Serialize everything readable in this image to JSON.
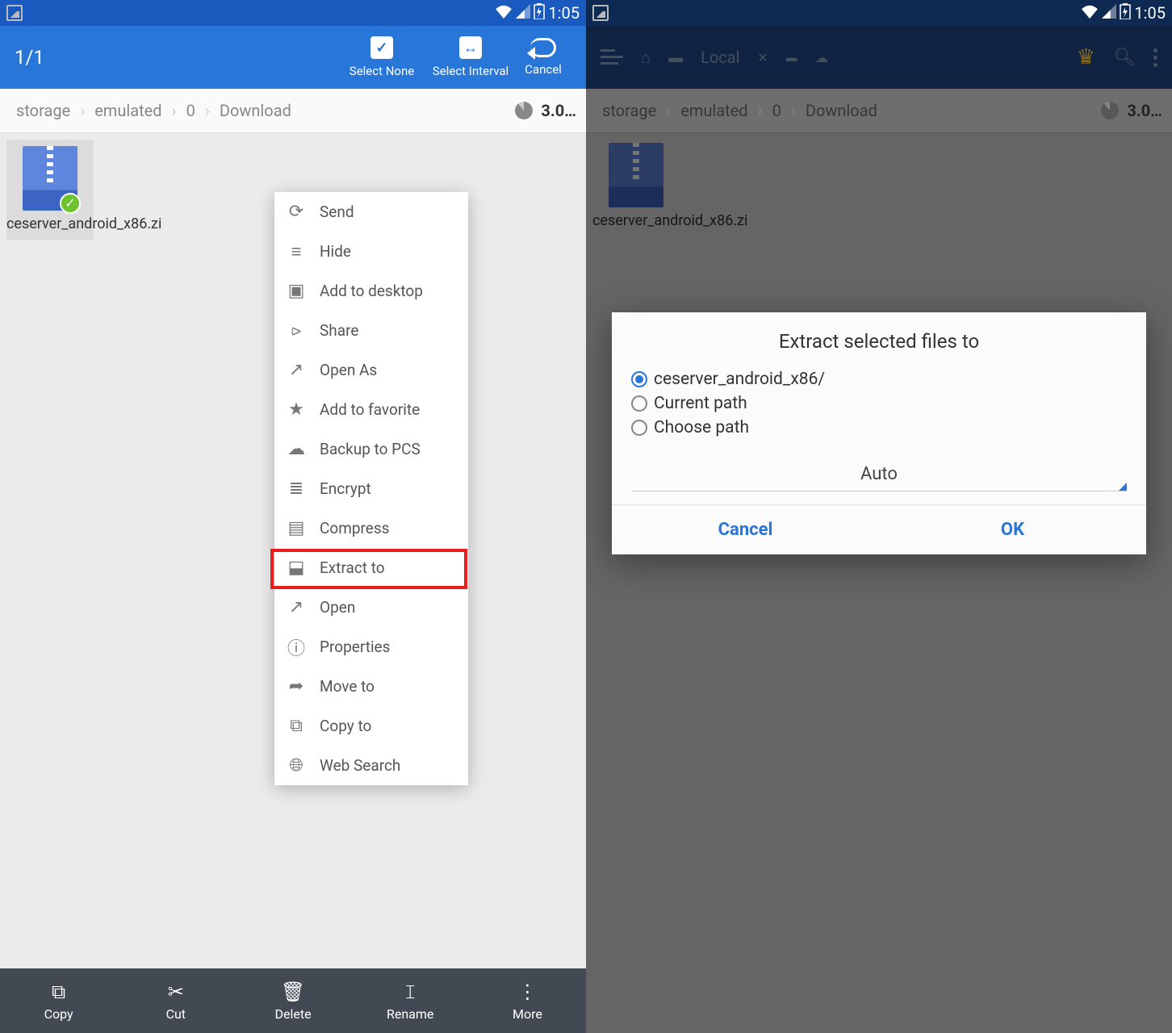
{
  "screen_left": {
    "status": {
      "time": "1:05"
    },
    "toolbar": {
      "count": "1/1",
      "select_none": "Select None",
      "select_interval": "Select Interval",
      "cancel": "Cancel"
    },
    "breadcrumb": [
      "storage",
      "emulated",
      "0",
      "Download"
    ],
    "storage_size": "3.0…",
    "file": {
      "name": "ceserver_android_x86.zi"
    },
    "context_menu": [
      "Send",
      "Hide",
      "Add to desktop",
      "Share",
      "Open As",
      "Add to favorite",
      "Backup to PCS",
      "Encrypt",
      "Compress",
      "Extract to",
      "Open",
      "Properties",
      "Move to",
      "Copy to",
      "Web Search"
    ],
    "bottom_bar": [
      "Copy",
      "Cut",
      "Delete",
      "Rename",
      "More"
    ]
  },
  "screen_right": {
    "status": {
      "time": "1:05"
    },
    "toolbar": {
      "local": "Local"
    },
    "breadcrumb": [
      "storage",
      "emulated",
      "0",
      "Download"
    ],
    "storage_size": "3.0…",
    "file": {
      "name": "ceserver_android_x86.zi"
    },
    "dialog": {
      "title": "Extract selected files to",
      "options": [
        "ceserver_android_x86/",
        "Current path",
        "Choose path"
      ],
      "dropdown": "Auto",
      "cancel": "Cancel",
      "ok": "OK"
    }
  }
}
